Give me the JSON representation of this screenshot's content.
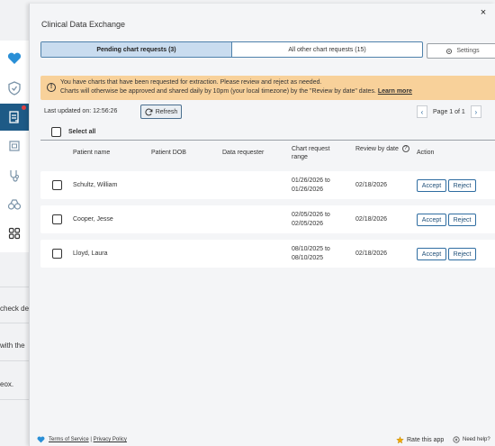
{
  "background": {
    "fragments": [
      "check de",
      "with the",
      "eox."
    ]
  },
  "panel": {
    "title": "Clinical Data Exchange",
    "close_label": "×"
  },
  "tabs": [
    {
      "label": "Pending chart requests (3)",
      "active": true
    },
    {
      "label": "All other chart requests (15)",
      "active": false
    }
  ],
  "settings_label": "Settings",
  "banner": {
    "line1": "You have charts that have been requested for extraction. Please review and reject as needed.",
    "line2": "Charts will otherwise be approved and shared daily by 10pm (your local timezone) by the \"Review by date\" dates.",
    "link": "Learn more"
  },
  "toolbar": {
    "last_updated": "Last updated on: 12:56:26",
    "refresh_label": "Refresh",
    "page_label": "Page 1 of 1"
  },
  "select_all_label": "Select all",
  "columns": {
    "patient_name": "Patient name",
    "patient_dob": "Patient DOB",
    "requester": "Data requester",
    "range": "Chart request range",
    "review_by": "Review by date",
    "action": "Action"
  },
  "rows": [
    {
      "name": "Schultz, William",
      "dob": "",
      "requester": "",
      "range_from": "01/26/2026 to",
      "range_to": "01/26/2026",
      "review_by": "02/18/2026"
    },
    {
      "name": "Cooper, Jesse",
      "dob": "",
      "requester": "",
      "range_from": "02/05/2026 to",
      "range_to": "02/05/2026",
      "review_by": "02/18/2026"
    },
    {
      "name": "Lloyd, Laura",
      "dob": "",
      "requester": "",
      "range_from": "08/10/2025 to",
      "range_to": "08/10/2025",
      "review_by": "02/18/2026"
    }
  ],
  "actions": {
    "accept": "Accept",
    "reject": "Reject"
  },
  "footer": {
    "terms": "Terms of Service",
    "separator": "|",
    "privacy": "Privacy Policy",
    "rate": "Rate this app",
    "help": "Need help?"
  },
  "colors": {
    "accent": "#2f6da1",
    "active_tab": "#c9dcef",
    "banner": "#f8d19a",
    "sidebar_active": "#1e5a86"
  }
}
